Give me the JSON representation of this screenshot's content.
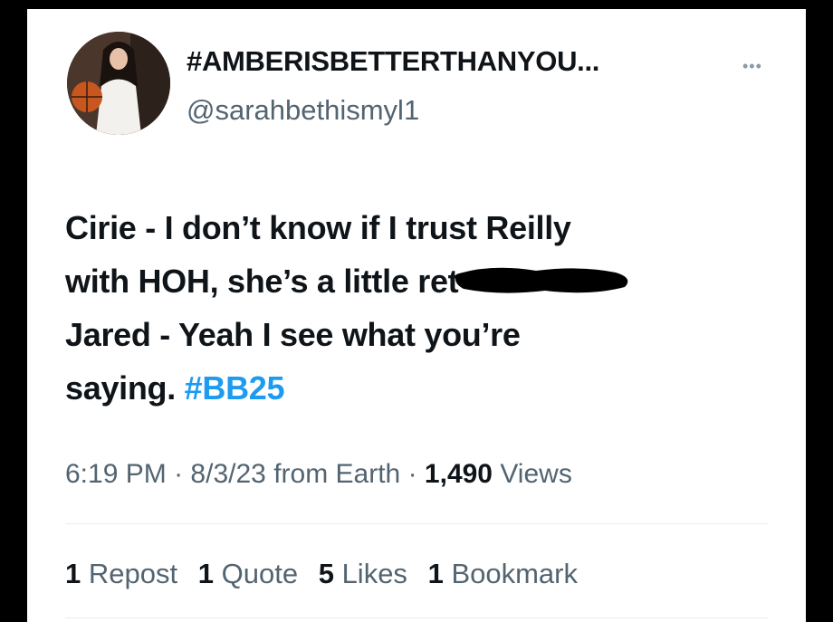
{
  "tweet": {
    "display_name": "#AMBERISBETTERTHANYOU...",
    "handle": "@sarahbethismyl1",
    "more_icon": "more-horizontal-icon",
    "text_lines": [
      "Cirie - I don’t know if I trust Reilly",
      "with HOH, she’s a little ret",
      "Jared - Yeah I see what you’re",
      "saying."
    ],
    "hashtag": "#BB25",
    "hashtag_color": "#1d9bf0",
    "time": "6:19 PM",
    "date": "8/3/23",
    "source": "from Earth",
    "views_count": "1,490",
    "views_label": "Views",
    "separator": "·",
    "stats": {
      "reposts_count": "1",
      "reposts_label": "Repost",
      "quotes_count": "1",
      "quotes_label": "Quote",
      "likes_count": "5",
      "likes_label": "Likes",
      "bookmarks_count": "1",
      "bookmarks_label": "Bookmark"
    }
  }
}
